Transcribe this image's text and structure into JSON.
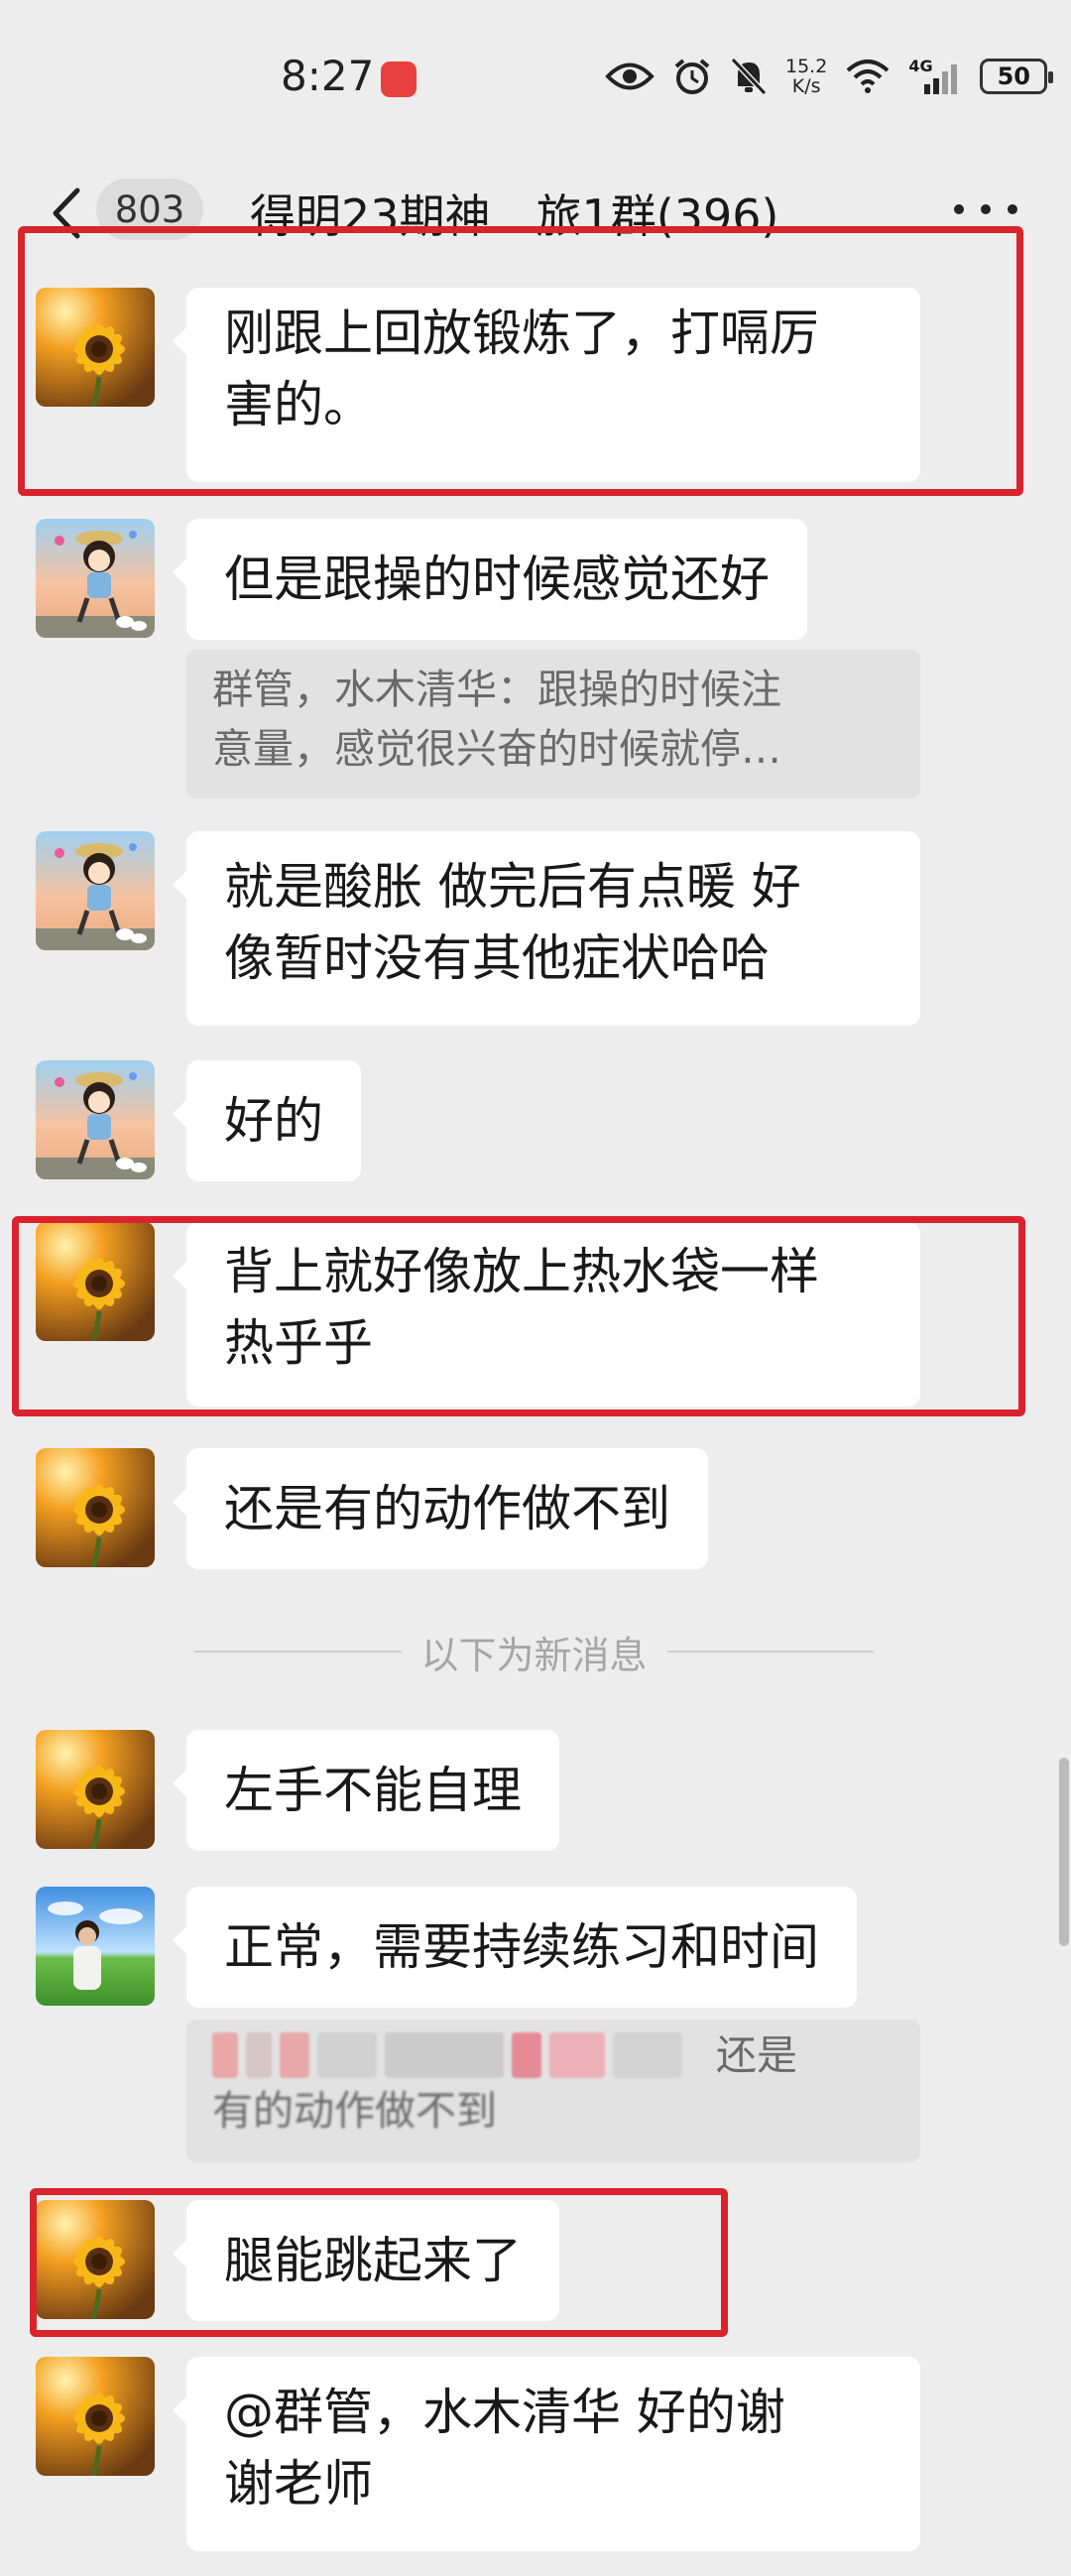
{
  "status_bar": {
    "time": "8:27",
    "net_speed_value": "15.2",
    "net_speed_unit": "K/s",
    "network_type": "4G",
    "battery": "50"
  },
  "header": {
    "unread_count": "803",
    "title": "得明23期神…旅1群(396)"
  },
  "messages": [
    {
      "text_lines": [
        "刚跟上回放锻炼了，打嗝厉",
        "害的。"
      ],
      "avatar": "sunflower-avatar"
    },
    {
      "text_lines": [
        "但是跟操的时候感觉还好"
      ],
      "avatar": "cartoon-girl-avatar",
      "quote_lines": [
        "群管，水木清华：跟操的时候注",
        "意量，感觉很兴奋的时候就停…"
      ]
    },
    {
      "text_lines": [
        "就是酸胀 做完后有点暖  好",
        "像暂时没有其他症状哈哈"
      ],
      "avatar": "cartoon-girl-avatar"
    },
    {
      "text_lines": [
        "好的"
      ],
      "avatar": "cartoon-girl-avatar"
    },
    {
      "text_lines": [
        "背上就好像放上热水袋一样",
        "热乎乎"
      ],
      "avatar": "sunflower-avatar"
    },
    {
      "text_lines": [
        "还是有的动作做不到"
      ],
      "avatar": "sunflower-avatar"
    },
    {
      "text_lines": [
        "左手不能自理"
      ],
      "avatar": "sunflower-avatar"
    },
    {
      "text_lines": [
        "正常，需要持续练习和时间"
      ],
      "avatar": "woman-outdoor-avatar",
      "quote_lines": [
        "还是",
        "有的动作做不到"
      ]
    },
    {
      "text_lines": [
        "腿能跳起来了"
      ],
      "avatar": "sunflower-avatar"
    },
    {
      "text_lines": [
        "@群管，水木清华  好的谢",
        "谢老师"
      ],
      "avatar": "sunflower-avatar"
    }
  ],
  "divider_text": "以下为新消息",
  "colors": {
    "highlight": "#d9232d",
    "background": "#ededed",
    "bubble": "#ffffff"
  }
}
